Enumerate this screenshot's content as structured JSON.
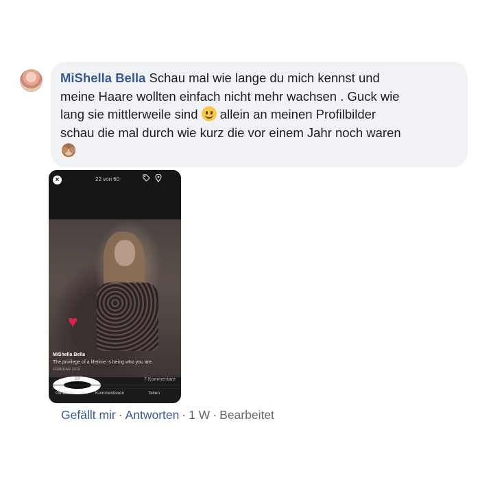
{
  "comment": {
    "author": "MiShella Bella",
    "text_line1": " Schau mal wie lange du mich kennst und",
    "text_line2": "meine Haare wollten einfach nicht mehr wachsen . Guck wie",
    "text_line3": "lang sie mittlerweile sind ",
    "text_line3b": " allein an meinen Profilbilder",
    "text_line4": "schau die mal durch wie kurz die vor einem Jahr noch waren",
    "emoji1": "smiling-face-emoji",
    "emoji2": "see-no-evil-monkey-emoji"
  },
  "attachment": {
    "counter": "22 von 60",
    "close_symbol": "×",
    "post_name": "MiShella Bella",
    "post_caption": "The privilege of a lifetime is being who you are.",
    "post_date": "FEBRUAR 2019",
    "reaction_count": "59",
    "comments_count": "7 Kommentare",
    "like_action": "Gefällt mir",
    "comment_action": "Kommentieren",
    "share_action": "Teilen"
  },
  "actions": {
    "like": "Gefällt mir",
    "dot1": "·",
    "reply": "Antworten",
    "dot2": "·",
    "time": "1 W",
    "dot3": "·",
    "edited": "Bearbeitet"
  },
  "colors": {
    "link_blue": "#385898",
    "bubble_bg": "#f0f2f5",
    "meta_gray": "#65676b"
  }
}
